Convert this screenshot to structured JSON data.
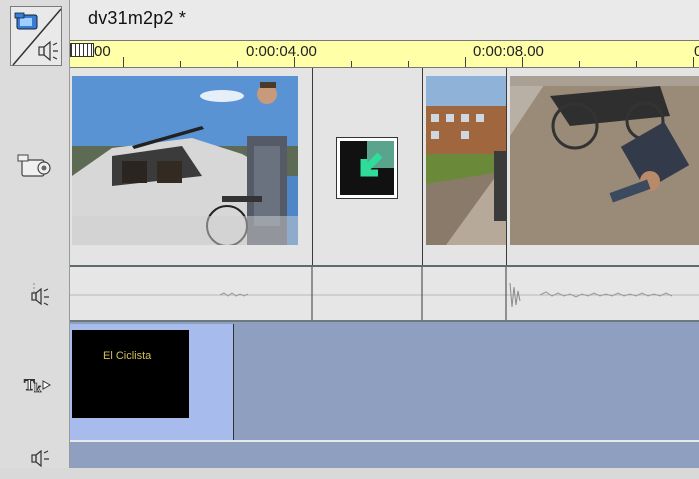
{
  "window": {
    "title": "dv31m2p2 *"
  },
  "ruler": {
    "labels": [
      "00",
      "0:00:04.00",
      "0:00:08.00",
      "0"
    ]
  },
  "video_track": {
    "clips": [
      {
        "name": "clip-car-scene"
      },
      {
        "name": "transition"
      },
      {
        "name": "clip-street"
      },
      {
        "name": "clip-bicycle-fall"
      }
    ]
  },
  "title_track": {
    "clip_text": "El Ciclista"
  },
  "colors": {
    "ruler_bg": "#ffffa8",
    "title_clip_bg": "#a7bbec",
    "title_track_bg": "#8f9fbf",
    "title_text": "#d6c05a",
    "transition_arrow": "#2fdc9a"
  },
  "icons": [
    "camera-icon",
    "speaker-icon",
    "title-track-icon"
  ]
}
